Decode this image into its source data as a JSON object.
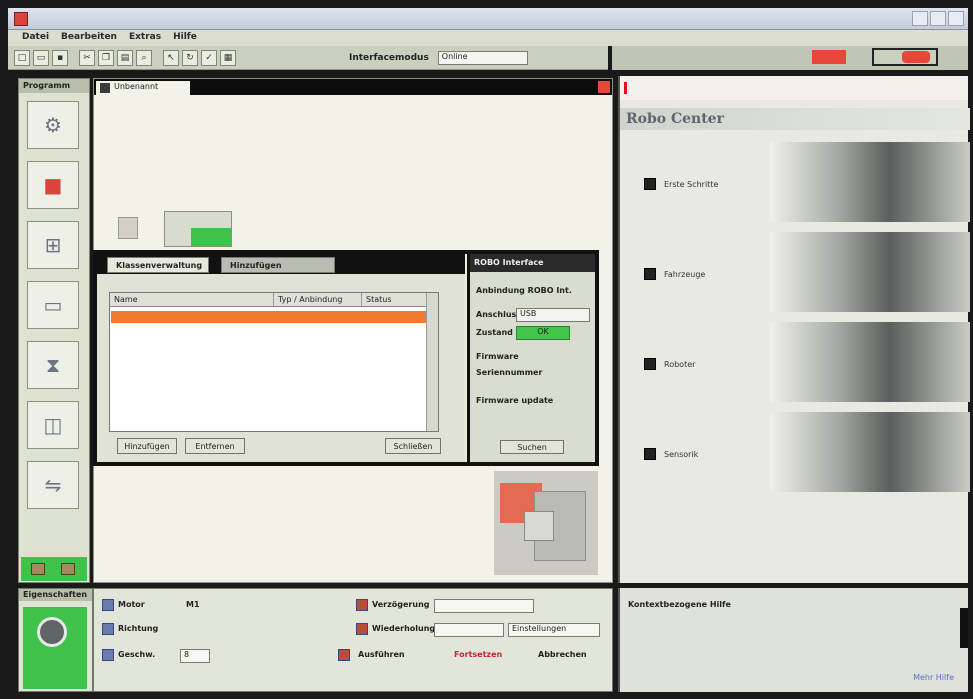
{
  "window": {
    "title": ""
  },
  "menubar": [
    "Datei",
    "Bearbeiten",
    "Extras",
    "Hilfe"
  ],
  "toolbar": {
    "label": "Interfacemodus",
    "select_value": "Online"
  },
  "sidebar": {
    "title": "Programm"
  },
  "canvas": {
    "tab_label": "Unbenannt"
  },
  "dialog": {
    "tabs": [
      "Klassenverwaltung",
      "Hinzufügen"
    ],
    "columns": [
      "Name",
      "Typ / Anbindung",
      "Status"
    ],
    "buttons": [
      "Hinzufügen",
      "Entfernen",
      "Schließen"
    ],
    "right": {
      "title": "ROBO Interface",
      "heading": "Anbindung ROBO Int.",
      "port_label": "Anschluss",
      "port_value": "USB",
      "status_label": "Zustand",
      "status_value": "OK",
      "firmware_label": "Firmware",
      "firmware_value": "",
      "serial_label": "Seriennummer",
      "serial_value": "",
      "version_label": "Firmware update",
      "version_value": "",
      "button": "Suchen"
    }
  },
  "right_panel": {
    "heading": "Robo Center",
    "items": [
      {
        "label": "Erste Schritte",
        "sub": ""
      },
      {
        "label": "Fahrzeuge",
        "sub": ""
      },
      {
        "label": "Roboter",
        "sub": ""
      },
      {
        "label": "Sensorik",
        "sub": ""
      }
    ]
  },
  "bottom_left": {
    "title": "Eigenschaften"
  },
  "bottom_mid": {
    "rows": [
      {
        "label": "Motor",
        "value": "M1"
      },
      {
        "label": "Richtung",
        "value": ""
      },
      {
        "label": "Geschw.",
        "value": "8"
      }
    ],
    "right_rows": [
      "Verzögerung",
      "Wiederholung",
      "Ausführen"
    ],
    "field1": "",
    "field2": "Einstellungen",
    "field3": "Fortsetzen",
    "field4": "Abbrechen"
  },
  "bottom_right": {
    "title": "Kontextbezogene Hilfe",
    "text": "",
    "link": "Mehr Hilfe"
  },
  "colors": {
    "accent_green": "#3fc14a",
    "accent_red": "#e7473b",
    "accent_orange": "#f07a2e"
  }
}
